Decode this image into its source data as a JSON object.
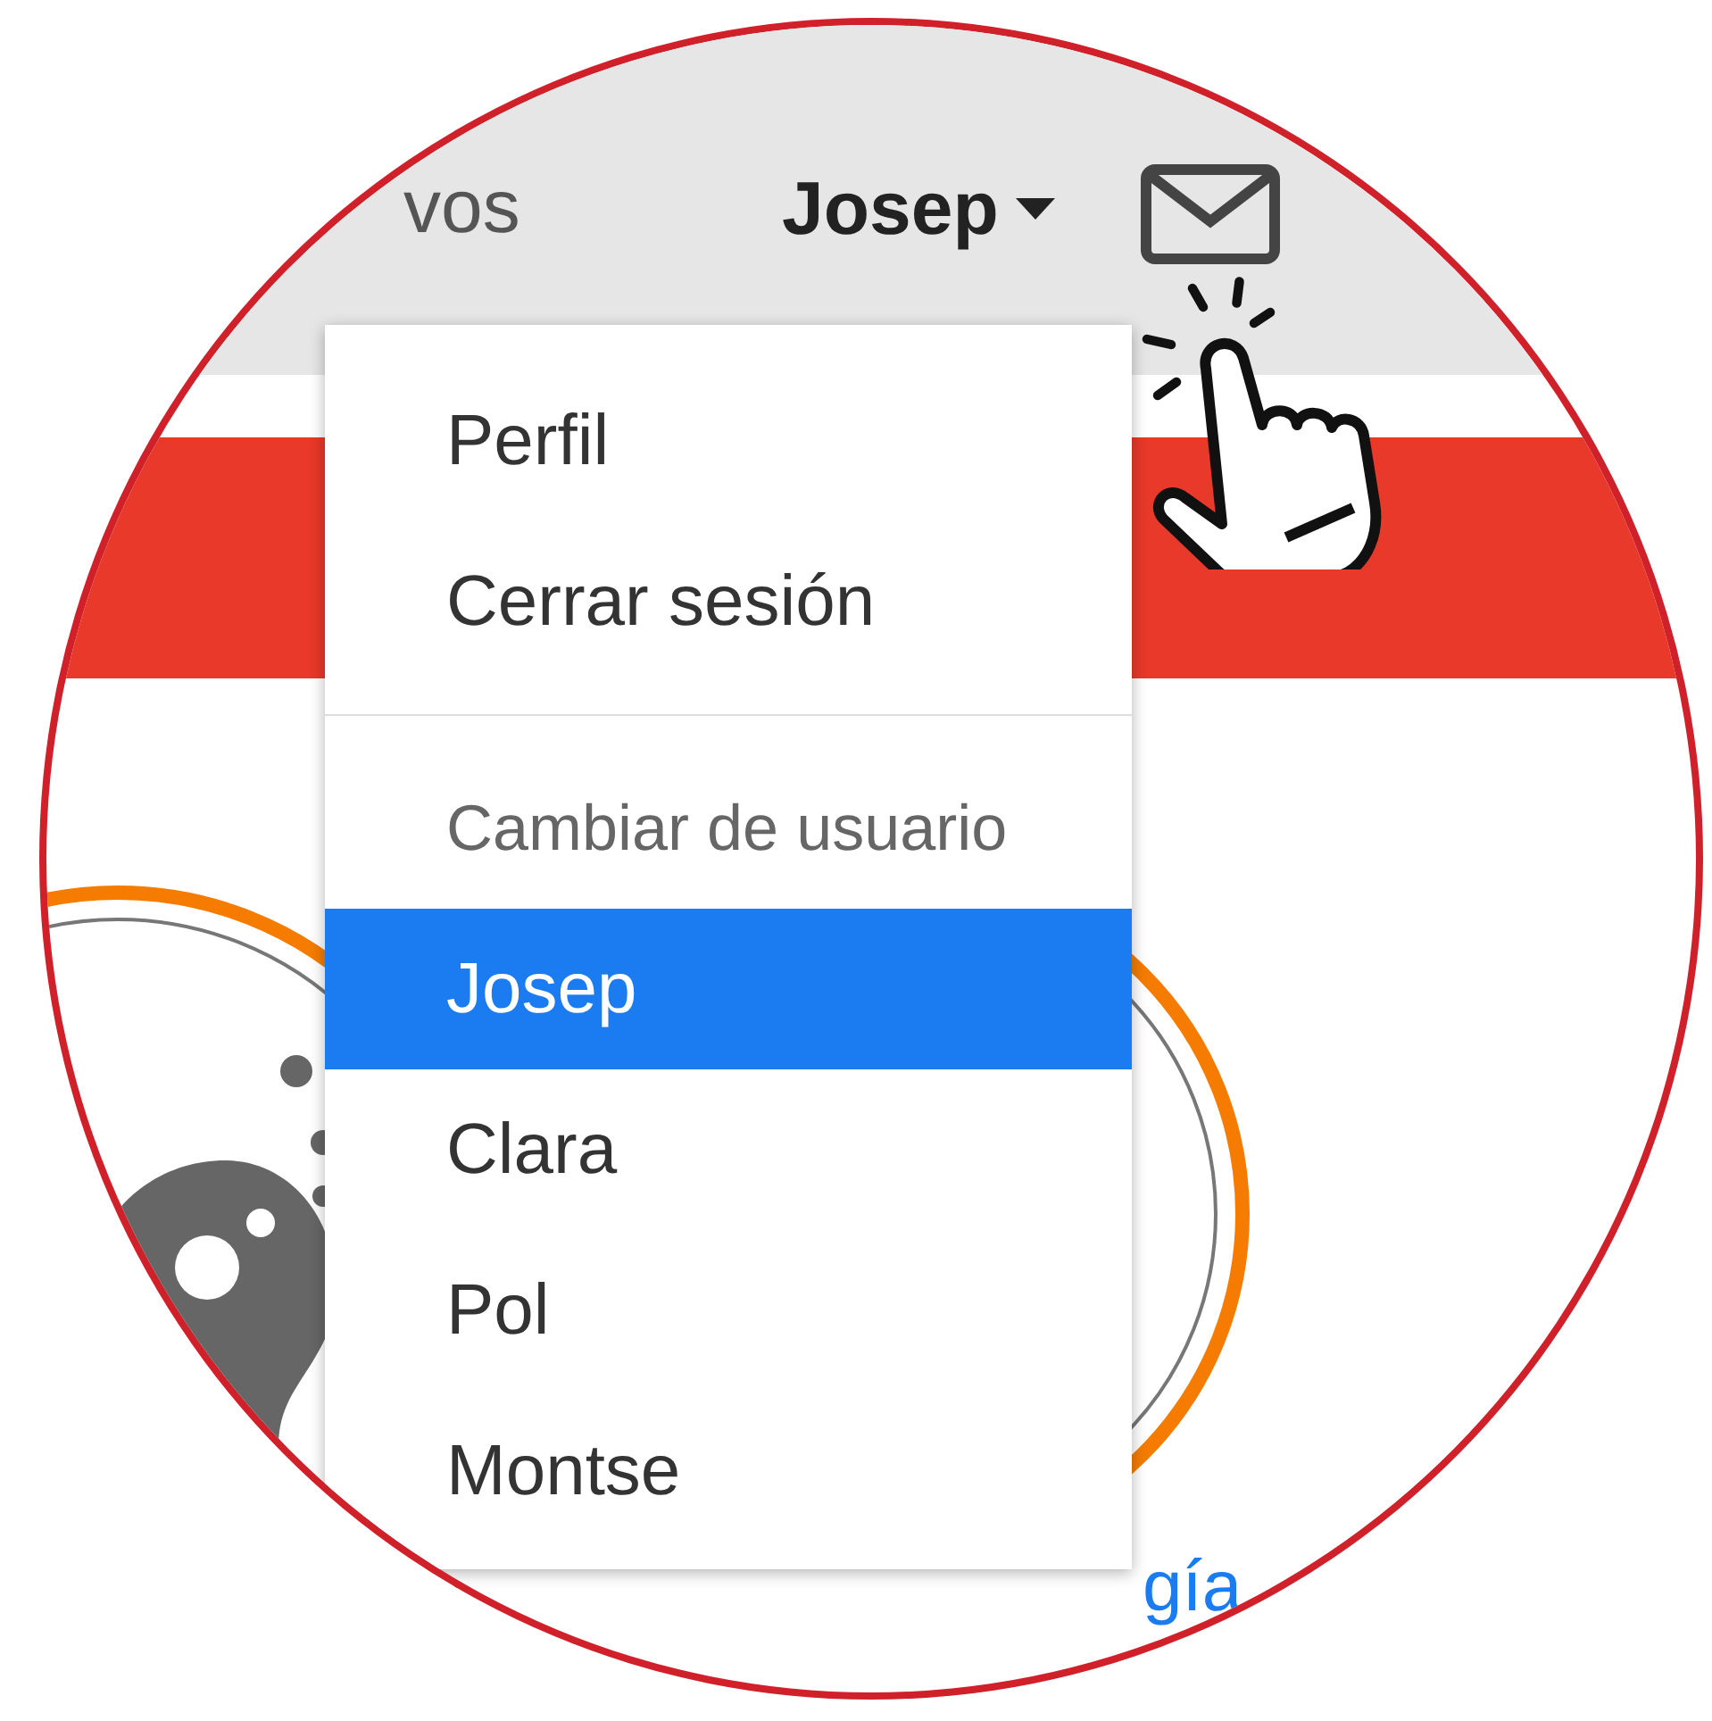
{
  "nav": {
    "partial_link": "vos",
    "user": "Josep"
  },
  "menu": {
    "items": [
      {
        "label": "Perfil"
      },
      {
        "label": "Cerrar sesión"
      }
    ],
    "section_header": "Cambiar de usuario",
    "users": [
      {
        "label": "Josep",
        "selected": true
      },
      {
        "label": "Clara",
        "selected": false
      },
      {
        "label": "Pol",
        "selected": false
      },
      {
        "label": "Montse",
        "selected": false
      }
    ]
  },
  "footer_link": "gía"
}
